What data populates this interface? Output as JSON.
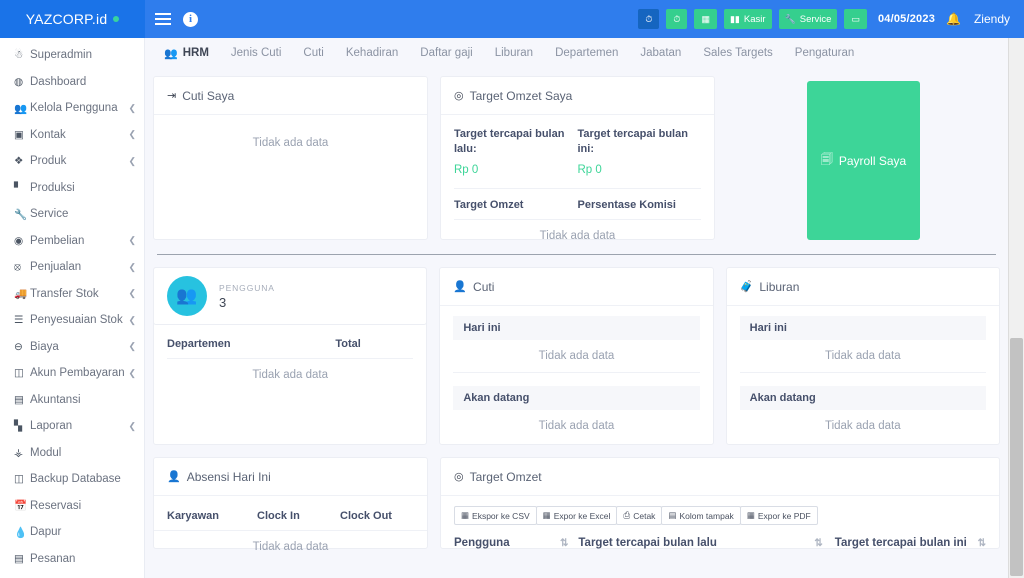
{
  "header": {
    "brand": "YAZCORP.id",
    "menu_icon": "hamburger-icon",
    "info_icon": "info-icon",
    "buttons": [
      {
        "label": "",
        "icon": "clock-in-icon",
        "style": "dark"
      },
      {
        "label": "",
        "icon": "clock-out-icon",
        "style": "green"
      },
      {
        "label": "",
        "icon": "calculator-icon",
        "style": "green"
      },
      {
        "label": "Kasir",
        "icon": "register-icon",
        "style": "green"
      },
      {
        "label": "Service",
        "icon": "wrench-icon",
        "style": "green"
      },
      {
        "label": "",
        "icon": "cash-icon",
        "style": "green"
      }
    ],
    "date": "04/05/2023",
    "bell_icon": "bell-icon",
    "user": "Ziendy"
  },
  "sidebar": {
    "items": [
      {
        "label": "Superadmin",
        "icon": "user-gear-icon",
        "chevron": false
      },
      {
        "label": "Dashboard",
        "icon": "gauge-icon",
        "chevron": false
      },
      {
        "label": "Kelola Pengguna",
        "icon": "users-icon",
        "chevron": true
      },
      {
        "label": "Kontak",
        "icon": "address-book-icon",
        "chevron": true
      },
      {
        "label": "Produk",
        "icon": "box-icon",
        "chevron": true
      },
      {
        "label": "Produksi",
        "icon": "factory-icon",
        "chevron": false
      },
      {
        "label": "Service",
        "icon": "wrench-icon",
        "chevron": false
      },
      {
        "label": "Pembelian",
        "icon": "cart-down-icon",
        "chevron": true
      },
      {
        "label": "Penjualan",
        "icon": "cart-up-icon",
        "chevron": true
      },
      {
        "label": "Transfer Stok",
        "icon": "truck-icon",
        "chevron": true
      },
      {
        "label": "Penyesuaian Stok",
        "icon": "layers-icon",
        "chevron": true
      },
      {
        "label": "Biaya",
        "icon": "minus-circle-icon",
        "chevron": true
      },
      {
        "label": "Akun Pembayaran",
        "icon": "card-id-icon",
        "chevron": true
      },
      {
        "label": "Akuntansi",
        "icon": "credit-card-icon",
        "chevron": false
      },
      {
        "label": "Laporan",
        "icon": "chart-bar-icon",
        "chevron": true
      },
      {
        "label": "Modul",
        "icon": "plug-icon",
        "chevron": false
      },
      {
        "label": "Backup Database",
        "icon": "database-icon",
        "chevron": false
      },
      {
        "label": "Reservasi",
        "icon": "calendar-icon",
        "chevron": false
      },
      {
        "label": "Dapur",
        "icon": "fire-icon",
        "chevron": false
      },
      {
        "label": "Pesanan",
        "icon": "list-icon",
        "chevron": false
      }
    ]
  },
  "tabs": [
    {
      "label": "HRM",
      "active": true,
      "icon": "users-icon"
    },
    {
      "label": "Jenis Cuti",
      "active": false,
      "icon": ""
    },
    {
      "label": "Cuti",
      "active": false,
      "icon": ""
    },
    {
      "label": "Kehadiran",
      "active": false,
      "icon": ""
    },
    {
      "label": "Daftar gaji",
      "active": false,
      "icon": ""
    },
    {
      "label": "Liburan",
      "active": false,
      "icon": ""
    },
    {
      "label": "Departemen",
      "active": false,
      "icon": ""
    },
    {
      "label": "Jabatan",
      "active": false,
      "icon": ""
    },
    {
      "label": "Sales Targets",
      "active": false,
      "icon": ""
    },
    {
      "label": "Pengaturan",
      "active": false,
      "icon": ""
    }
  ],
  "cuti_saya": {
    "title": "Cuti Saya",
    "icon": "sign-out-icon",
    "empty": "Tidak ada data"
  },
  "target_omzet_saya": {
    "title": "Target Omzet Saya",
    "icon": "bullseye-icon",
    "last_month_label": "Target tercapai bulan lalu:",
    "last_month_value": "Rp 0",
    "this_month_label": "Target tercapai bulan ini:",
    "this_month_value": "Rp 0",
    "col_target": "Target Omzet",
    "col_commission": "Persentase Komisi",
    "empty": "Tidak ada data"
  },
  "payroll": {
    "label": "Payroll Saya",
    "icon": "money-stack-icon"
  },
  "pengguna": {
    "kicker": "PENGGUNA",
    "count": "3",
    "icon": "users-icon",
    "col_dept": "Departemen",
    "col_total": "Total",
    "empty": "Tidak ada data"
  },
  "cuti": {
    "title": "Cuti",
    "icon": "user-times-icon",
    "today_label": "Hari ini",
    "today_empty": "Tidak ada data",
    "upcoming_label": "Akan datang",
    "upcoming_empty": "Tidak ada data"
  },
  "liburan": {
    "title": "Liburan",
    "icon": "suitcase-icon",
    "today_label": "Hari ini",
    "today_empty": "Tidak ada data",
    "upcoming_label": "Akan datang",
    "upcoming_empty": "Tidak ada data"
  },
  "absensi": {
    "title": "Absensi Hari Ini",
    "icon": "user-check-icon",
    "col_employee": "Karyawan",
    "col_clock_in": "Clock In",
    "col_clock_out": "Clock Out",
    "empty": "Tidak ada data"
  },
  "target_omzet": {
    "title": "Target Omzet",
    "icon": "bullseye-icon",
    "tools": [
      {
        "label": "Ekspor ke CSV",
        "icon": "file-csv-icon"
      },
      {
        "label": "Expor ke Excel",
        "icon": "file-excel-icon"
      },
      {
        "label": "Cetak",
        "icon": "print-icon"
      },
      {
        "label": "Kolom tampak",
        "icon": "columns-icon"
      },
      {
        "label": "Expor ke PDF",
        "icon": "file-pdf-icon"
      }
    ],
    "col_user": "Pengguna",
    "col_last_month": "Target tercapai bulan lalu",
    "col_this_month": "Target tercapai bulan ini"
  },
  "colors": {
    "header_blue": "#2f7ded",
    "brand_blue": "#1a73e8",
    "green": "#3dd598",
    "cyan": "#27c2e0",
    "bg": "#f6f7fc"
  }
}
